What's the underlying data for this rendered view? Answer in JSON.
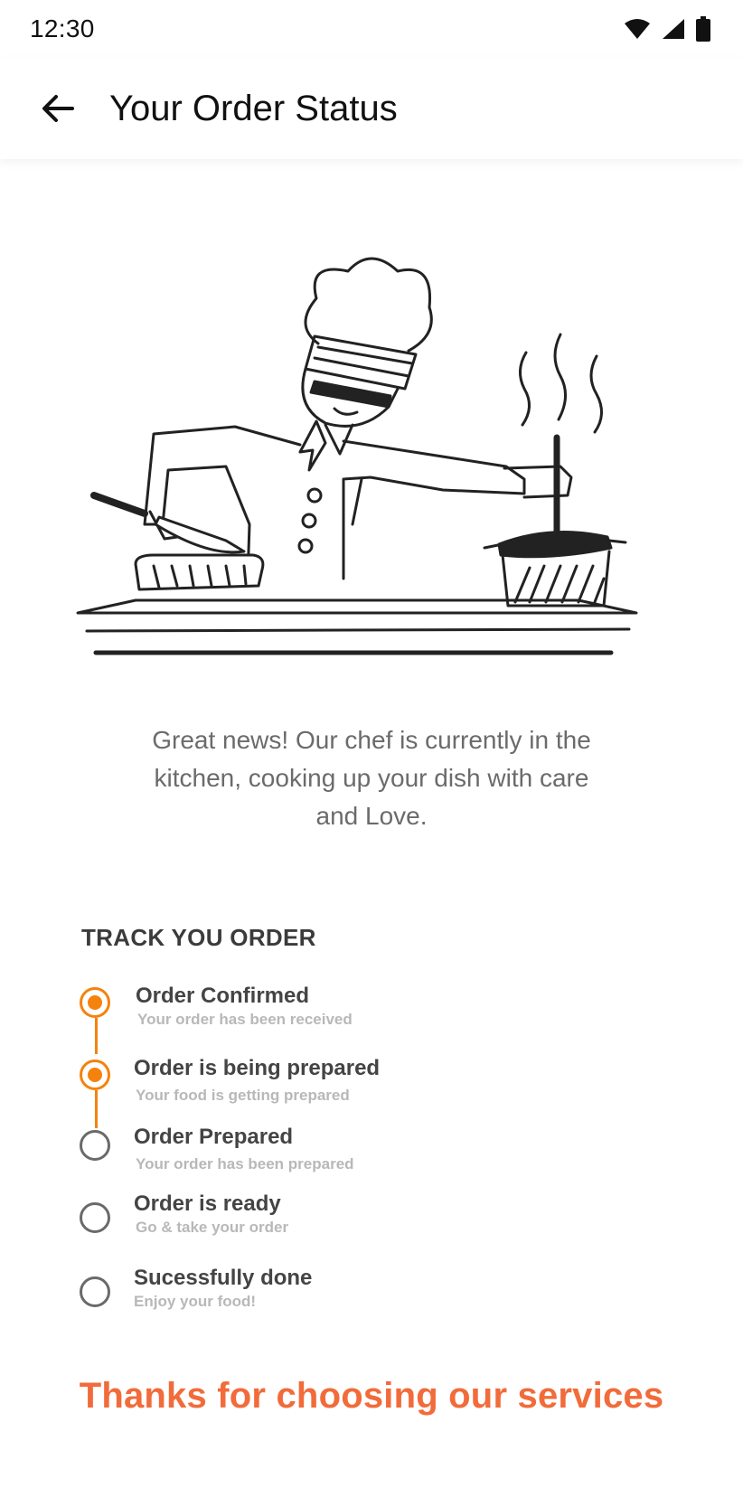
{
  "status_bar": {
    "time": "12:30"
  },
  "header": {
    "title": "Your Order Status"
  },
  "message": "Great news! Our chef is currently in the kitchen, cooking up your dish with care and Love.",
  "track": {
    "title": "TRACK YOU ORDER",
    "steps": [
      {
        "title": "Order Confirmed",
        "subtitle": "Your order has been received",
        "done": true
      },
      {
        "title": "Order is being prepared",
        "subtitle": "Your food is getting prepared",
        "done": true
      },
      {
        "title": "Order Prepared",
        "subtitle": "Your order has been prepared",
        "done": false
      },
      {
        "title": "Order is ready",
        "subtitle": "Go & take your order",
        "done": false
      },
      {
        "title": "Sucessfully done",
        "subtitle": "Enjoy your food!",
        "done": false
      }
    ]
  },
  "footer": {
    "thanks": "Thanks for choosing our services"
  },
  "colors": {
    "accent": "#f5820d",
    "thanks": "#f26b3a",
    "inactive": "#6a6a6a"
  },
  "icons": [
    "back-arrow-icon",
    "wifi-icon",
    "cell-signal-icon",
    "battery-icon"
  ]
}
